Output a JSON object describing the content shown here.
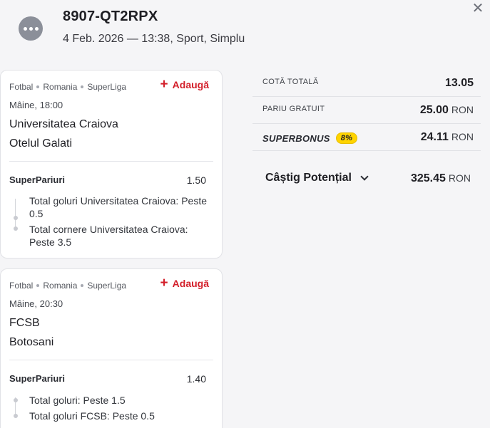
{
  "header": {
    "ticket_id": "8907-QT2RPX",
    "meta": "4 Feb. 2026 — 13:38, Sport, Simplu",
    "close_glyph": "✕"
  },
  "events": [
    {
      "breadcrumb": [
        "Fotbal",
        "Romania",
        "SuperLiga"
      ],
      "add_label": "Adaugă",
      "time": "Mâine, 18:00",
      "team_home": "Universitatea Craiova",
      "team_away": "Otelul Galati",
      "market": "SuperPariuri",
      "odds": "1.50",
      "selections": [
        "Total goluri Universitatea Craiova: Peste 0.5",
        "Total cornere Universitatea Craiova: Peste 3.5"
      ]
    },
    {
      "breadcrumb": [
        "Fotbal",
        "Romania",
        "SuperLiga"
      ],
      "add_label": "Adaugă",
      "time": "Mâine, 20:30",
      "team_home": "FCSB",
      "team_away": "Botosani",
      "market": "SuperPariuri",
      "odds": "1.40",
      "selections": [
        "Total goluri: Peste 1.5",
        "Total goluri FCSB: Peste 0.5"
      ]
    }
  ],
  "summary": {
    "total_odds_label": "COTĂ TOTALĂ",
    "total_odds_value": "13.05",
    "free_bet_label": "PARIU GRATUIT",
    "free_bet_value": "25.00",
    "currency": "RON",
    "superbonus_label": "SUPERBONUS",
    "superbonus_badge": "8%",
    "superbonus_value": "24.11",
    "potential_label": "Câștig Potențial",
    "potential_value": "325.45"
  },
  "colors": {
    "accent_red": "#d31f2a",
    "badge_yellow": "#ffd400",
    "background": "#f5f5f7"
  }
}
